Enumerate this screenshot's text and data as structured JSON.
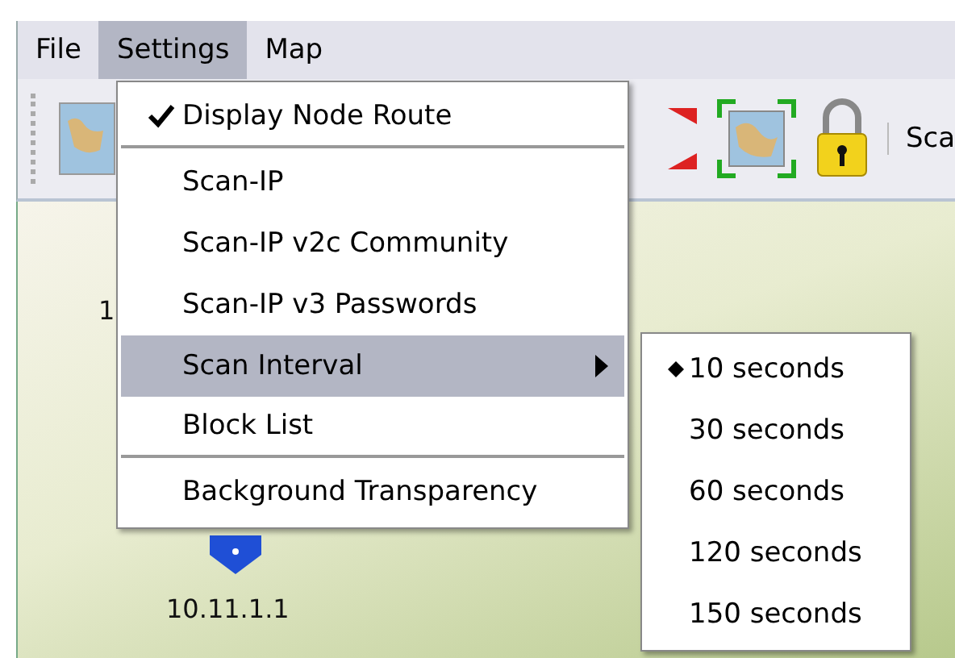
{
  "menu_bar": [
    {
      "label": "File",
      "selected": false
    },
    {
      "label": "Settings",
      "selected": true
    },
    {
      "label": "Map",
      "selected": false
    }
  ],
  "toolbar": {
    "label": "Sca"
  },
  "map": {
    "labels": [
      "1",
      "10.11.1.1"
    ]
  },
  "settings_menu": {
    "items": [
      {
        "label": "Display Node Route",
        "checked": true,
        "selected": false,
        "submenu": false,
        "separator_after": true
      },
      {
        "label": "Scan-IP",
        "checked": false,
        "selected": false,
        "submenu": false,
        "separator_after": false
      },
      {
        "label": "Scan-IP v2c Community",
        "checked": false,
        "selected": false,
        "submenu": false,
        "separator_after": false
      },
      {
        "label": "Scan-IP v3 Passwords",
        "checked": false,
        "selected": false,
        "submenu": false,
        "separator_after": false
      },
      {
        "label": "Scan Interval",
        "checked": false,
        "selected": true,
        "submenu": true,
        "separator_after": false
      },
      {
        "label": "Block List",
        "checked": false,
        "selected": false,
        "submenu": false,
        "separator_after": true
      },
      {
        "label": "Background Transparency",
        "checked": false,
        "selected": false,
        "submenu": false,
        "separator_after": false
      }
    ]
  },
  "interval_menu": {
    "items": [
      {
        "label": "10 seconds",
        "selected": true
      },
      {
        "label": "30 seconds",
        "selected": false
      },
      {
        "label": "60 seconds",
        "selected": false
      },
      {
        "label": "120 seconds",
        "selected": false
      },
      {
        "label": "150 seconds",
        "selected": false
      }
    ]
  }
}
